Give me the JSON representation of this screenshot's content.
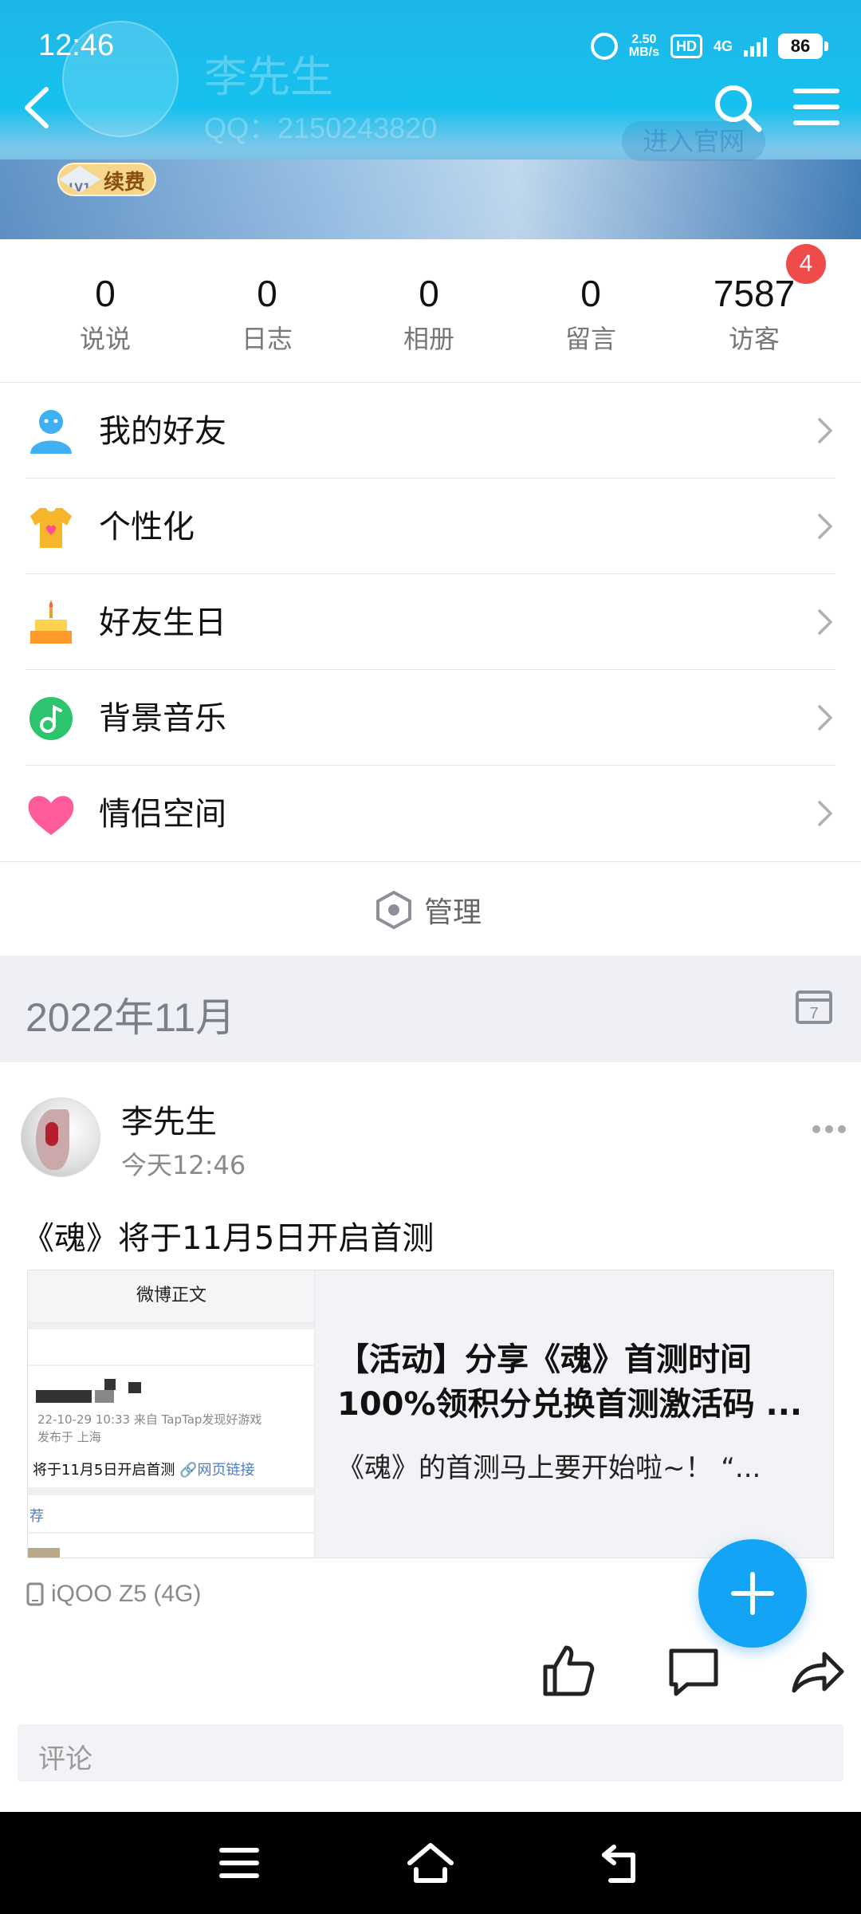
{
  "status_bar": {
    "time": "12:46",
    "speed_value": "2.50",
    "speed_unit": "MB/s",
    "hd": "HD",
    "network": "4G",
    "battery": "86"
  },
  "header": {
    "name": "李先生",
    "qq": "QQ：2150243820",
    "official_site": "进入官网",
    "level": "LV1",
    "renew": "续费"
  },
  "stats": [
    {
      "value": "0",
      "label": "说说"
    },
    {
      "value": "0",
      "label": "日志"
    },
    {
      "value": "0",
      "label": "相册"
    },
    {
      "value": "0",
      "label": "留言"
    },
    {
      "value": "7587",
      "label": "访客"
    }
  ],
  "visitor_badge": "4",
  "menu": [
    {
      "label": "我的好友",
      "icon": "friends-icon"
    },
    {
      "label": "个性化",
      "icon": "tshirt-icon"
    },
    {
      "label": "好友生日",
      "icon": "birthday-cake-icon"
    },
    {
      "label": "背景音乐",
      "icon": "music-note-icon"
    },
    {
      "label": "情侣空间",
      "icon": "heart-icon"
    }
  ],
  "manage_label": "管理",
  "month_label": "2022年11月",
  "calendar_day": "7",
  "post": {
    "author": "李先生",
    "time": "今天12:46",
    "text": "《魂》将于11月5日开启首测",
    "card": {
      "thumb_title": "微博正文",
      "thumb_meta1": "22-10-29 10:33  来自 TapTap发现好游戏",
      "thumb_meta2": "发布于 上海",
      "thumb_main": "将于11月5日开启首测",
      "thumb_link": "🔗网页链接",
      "thumb_rec": "荐",
      "title": "【活动】分享《魂》首测时间100%领积分兑换首测激活码 ...",
      "desc": "《魂》的首测马上要开始啦~！  “..."
    },
    "device": "iQOO Z5 (4G)",
    "comment_placeholder": "评论"
  },
  "colors": {
    "accent": "#14a4f5",
    "badge": "#f04b4b"
  }
}
